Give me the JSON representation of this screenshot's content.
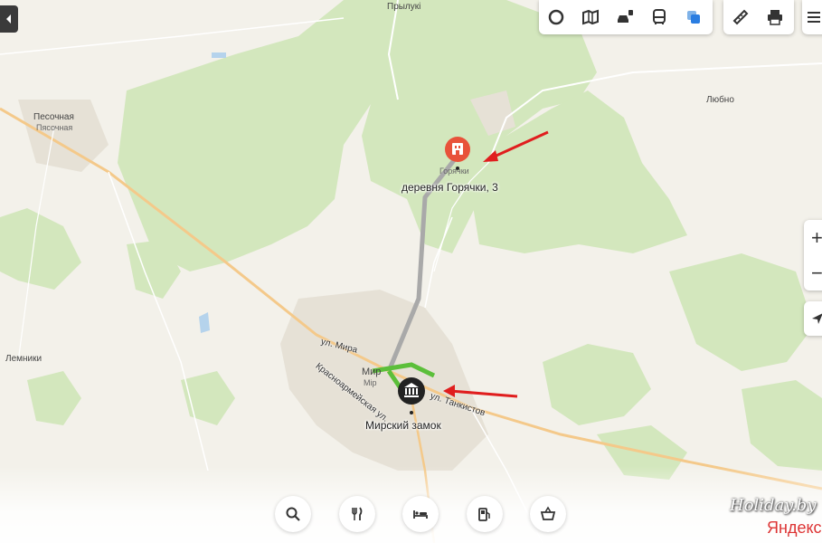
{
  "map": {
    "place_labels": [
      {
        "id": "pryluki",
        "text": "Прылукі"
      },
      {
        "id": "pesochnaya",
        "text": "Песочная"
      },
      {
        "id": "pyasochnaya",
        "text": "Пясочная"
      },
      {
        "id": "lyubno",
        "text": "Любно"
      },
      {
        "id": "lemniki",
        "text": "Лемники"
      },
      {
        "id": "mir",
        "text": "Мир"
      },
      {
        "id": "mir_be",
        "text": "Mip"
      },
      {
        "id": "goryachki_small",
        "text": "Горячки"
      }
    ],
    "street_labels": [
      {
        "id": "mira",
        "text": "ул. Мира"
      },
      {
        "id": "krasnoarmeyskaya",
        "text": "Красноармейская ул."
      },
      {
        "id": "tankistov",
        "text": "ул. Танкистов"
      }
    ],
    "pins": {
      "destination": {
        "label": "деревня Горячки, 3",
        "icon": "hotel-icon",
        "color": "#e8523a"
      },
      "origin": {
        "label": "Мирский замок",
        "icon": "museum-icon",
        "color": "#222222"
      }
    },
    "route_colors": {
      "main": "#a9a9a9",
      "traffic": "#5cbf3a"
    },
    "annotation_color": "#e01e1e"
  },
  "toolbar": {
    "layers": [
      "traffic-layer-icon",
      "panorama-icon",
      "traffic-jam-icon",
      "transit-icon",
      "layers-icon"
    ],
    "tools": [
      "ruler-icon",
      "print-icon"
    ]
  },
  "zoom": {
    "in": "+",
    "out": "−"
  },
  "bottom_bar": [
    "search-icon",
    "restaurant-icon",
    "hotel-bed-icon",
    "fuel-icon",
    "shop-icon"
  ],
  "branding": {
    "watermark": "Holiday.by",
    "provider": "Яндекс"
  }
}
